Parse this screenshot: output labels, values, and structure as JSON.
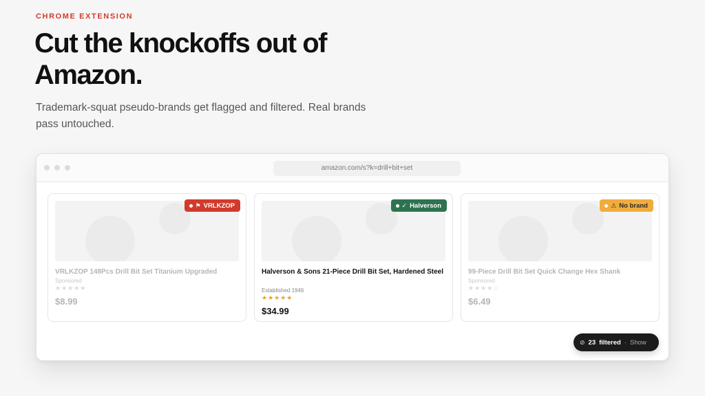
{
  "hero": {
    "eyebrow": "CHROME EXTENSION",
    "headline": "Cut the knockoffs out of Amazon.",
    "subhead": "Trademark-squat pseudo-brands get flagged and filtered. Real brands pass untouched."
  },
  "browser": {
    "url": "amazon.com/s?k=drill+bit+set"
  },
  "products": [
    {
      "badge": "VRLKZOP",
      "badge_icon": "flag-icon",
      "badge_color": "#d23a2b",
      "title": "VRLKZOP 148Pcs Drill Bit Set Titanium Upgraded",
      "subtitle": "Sponsored",
      "rating": 0,
      "stars": "★★★★★",
      "price": "$8.99",
      "filtered": true
    },
    {
      "badge": "Halverson",
      "badge_icon": "check-circle-icon",
      "badge_color": "#2e7350",
      "title": "Halverson & Sons 21-Piece Drill Bit Set, Hardened Steel",
      "subtitle": "Established 1946",
      "rating": 5,
      "stars": "★★★★★",
      "price": "$34.99",
      "filtered": false
    },
    {
      "badge": "No brand",
      "badge_icon": "warning-icon",
      "badge_color": "#f0ac3c",
      "title": "99-Piece Drill Bit Set Quick Change Hex Shank",
      "subtitle": "Sponsored",
      "rating": 0,
      "stars": "★★★★☆",
      "price": "$6.49",
      "filtered": true
    }
  ],
  "filter_pill": {
    "icon": "filter-tag-icon",
    "count": "23",
    "label": "filtered",
    "separator": "·",
    "action": "Show"
  }
}
